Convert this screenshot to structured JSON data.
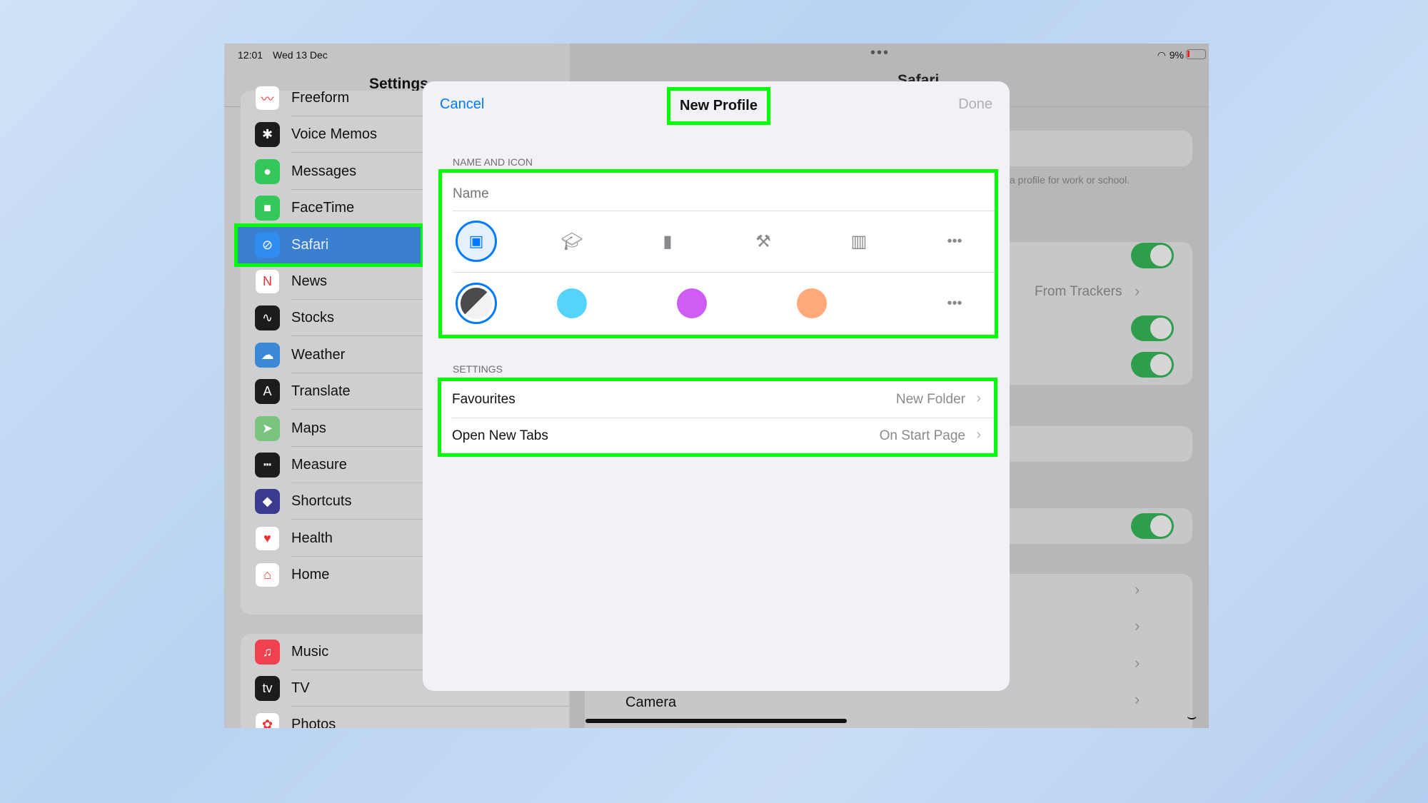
{
  "status_bar": {
    "time": "12:01",
    "date": "Wed 13 Dec",
    "battery": "9%"
  },
  "sidebar": {
    "title": "Settings",
    "items": [
      {
        "label": "Freeform",
        "color": "#ffffff",
        "glyph": "〰"
      },
      {
        "label": "Voice Memos",
        "color": "#1c1c1e",
        "glyph": "✱"
      },
      {
        "label": "Messages",
        "color": "#34c759",
        "glyph": "●"
      },
      {
        "label": "FaceTime",
        "color": "#34c759",
        "glyph": "■"
      },
      {
        "label": "Safari",
        "color": "#2f8cf0",
        "glyph": "⊘",
        "selected": true
      },
      {
        "label": "News",
        "color": "#ffffff",
        "glyph": "N"
      },
      {
        "label": "Stocks",
        "color": "#1c1c1e",
        "glyph": "∿"
      },
      {
        "label": "Weather",
        "color": "#3a88d6",
        "glyph": "☁"
      },
      {
        "label": "Translate",
        "color": "#1c1c1e",
        "glyph": "A"
      },
      {
        "label": "Maps",
        "color": "#7bc47f",
        "glyph": "➤"
      },
      {
        "label": "Measure",
        "color": "#1c1c1e",
        "glyph": "┅"
      },
      {
        "label": "Shortcuts",
        "color": "#3b3a8f",
        "glyph": "◆"
      },
      {
        "label": "Health",
        "color": "#ffffff",
        "glyph": "♥"
      },
      {
        "label": "Home",
        "color": "#ffffff",
        "glyph": "⌂"
      },
      {
        "label": "Music",
        "color": "#f0414f",
        "glyph": "♫"
      },
      {
        "label": "TV",
        "color": "#1c1c1e",
        "glyph": "tv"
      },
      {
        "label": "Photos",
        "color": "#ffffff",
        "glyph": "✿"
      }
    ]
  },
  "detail": {
    "title": "Safari",
    "profile_hint": "a profile for work or school.",
    "tracking_value": "From Trackers",
    "camera_label": "Camera"
  },
  "modal": {
    "cancel": "Cancel",
    "title": "New Profile",
    "done": "Done",
    "name_icon_header": "NAME AND ICON",
    "name_placeholder": "Name",
    "icons": [
      "person-badge-icon",
      "graduation-cap-icon",
      "briefcase-icon",
      "hammer-icon",
      "building-icon",
      "more-icon"
    ],
    "selected_icon": "person-badge-icon",
    "colors": [
      "#4a4a4a",
      "#55d4fb",
      "#d05cf6",
      "#ffa97b"
    ],
    "selected_color": "#4a4a4a",
    "accent": "#007aff",
    "settings_header": "SETTINGS",
    "rows": [
      {
        "label": "Favourites",
        "value": "New Folder"
      },
      {
        "label": "Open New Tabs",
        "value": "On Start Page"
      }
    ]
  }
}
